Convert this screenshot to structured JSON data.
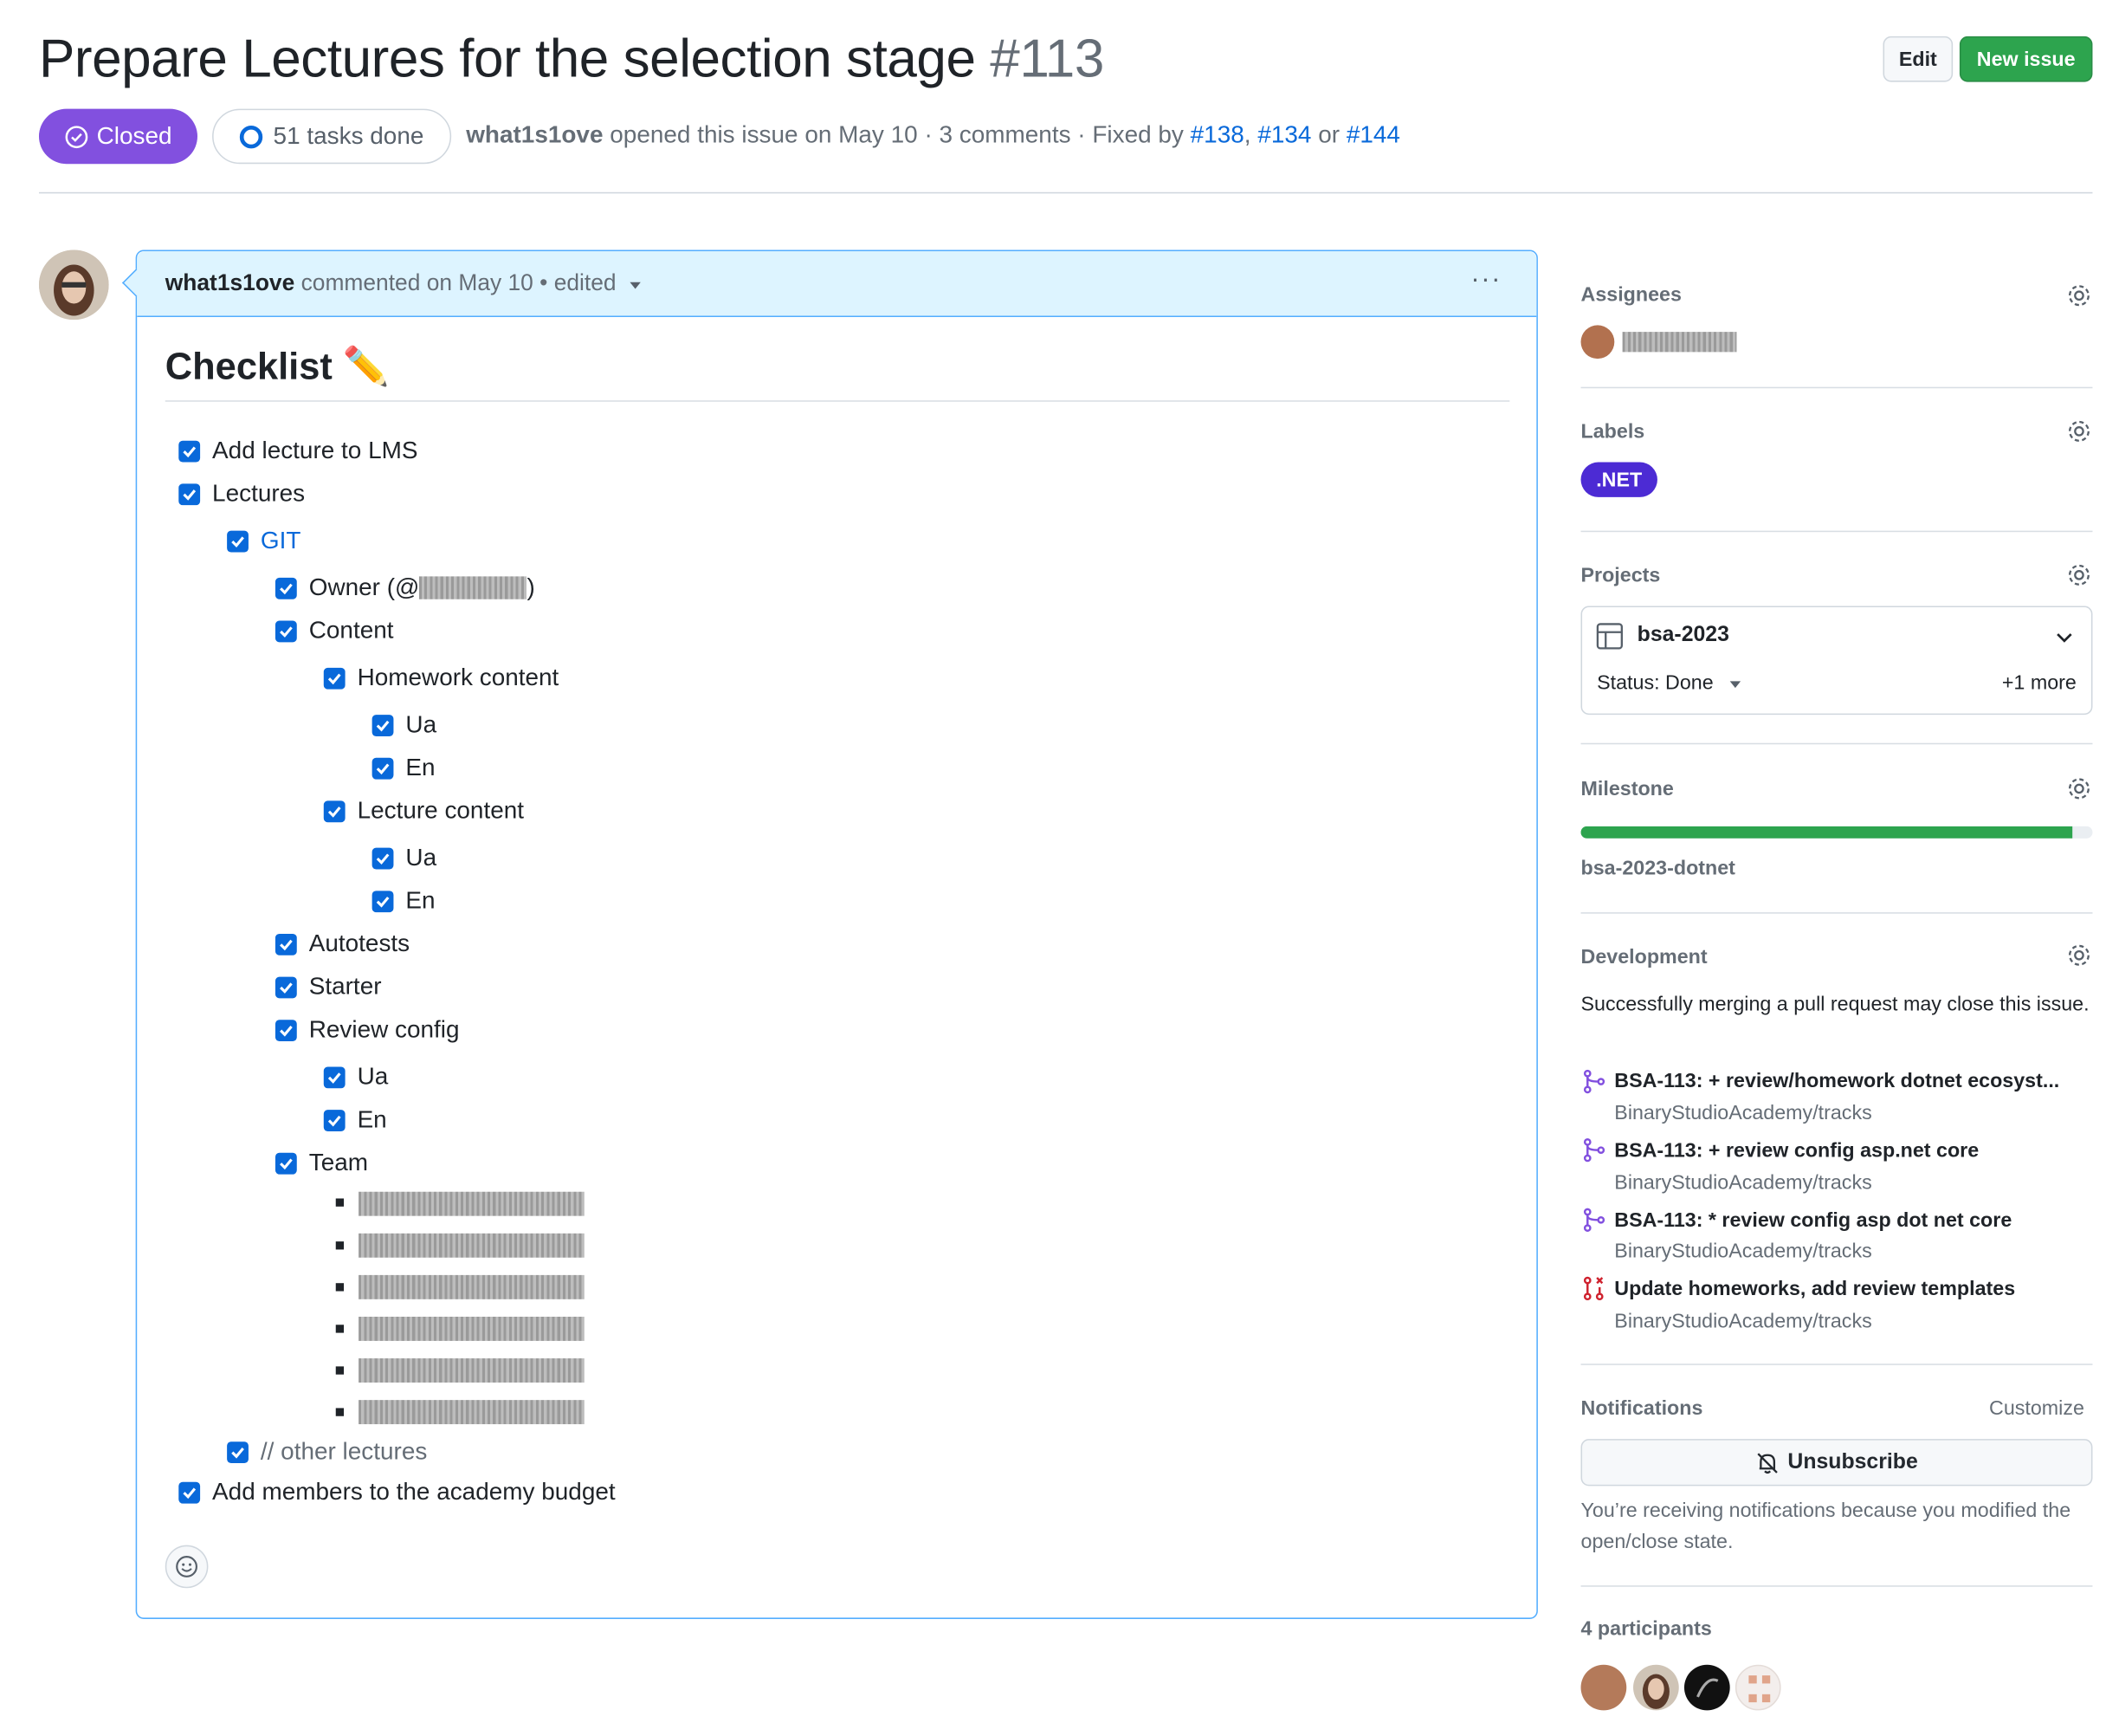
{
  "issue": {
    "title": "Prepare Lectures for the selection stage",
    "number": "#113",
    "state": "Closed",
    "tasks": "51 tasks done",
    "author": "what1s1ove",
    "opened_text": "opened this issue on May 10 · 3 comments · Fixed by",
    "fixed_by": [
      "#138",
      "#134",
      "#144"
    ],
    "sep_comma": ",",
    "sep_or": "or"
  },
  "header_buttons": {
    "edit": "Edit",
    "new_issue": "New issue"
  },
  "comment": {
    "author": "what1s1ove",
    "meta": "commented on May 10 • edited",
    "menu": "···",
    "heading": "Checklist ✏️",
    "items": {
      "add_lecture": "Add lecture to LMS",
      "lectures": "Lectures",
      "git": "GIT",
      "owner_prefix": "Owner (@",
      "owner_suffix": ")",
      "content": "Content",
      "homework_content": "Homework content",
      "ua1": "Ua",
      "en1": "En",
      "lecture_content": "Lecture content",
      "ua2": "Ua",
      "en2": "En",
      "autotests": "Autotests",
      "starter": "Starter",
      "review_config": "Review config",
      "ua3": "Ua",
      "en3": "En",
      "team": "Team",
      "other_lectures": "// other lectures",
      "add_members": "Add members to the academy budget"
    }
  },
  "sidebar": {
    "assignees": "Assignees",
    "labels": "Labels",
    "label_net": ".NET",
    "projects": "Projects",
    "project_name": "bsa-2023",
    "project_status": "Status: Done",
    "project_more": "+1 more",
    "milestone": "Milestone",
    "milestone_name": "bsa-2023-dotnet",
    "milestone_progress": 0.96,
    "development": "Development",
    "development_text": "Successfully merging a pull request may close this issue.",
    "prs": [
      {
        "title": "BSA-113: + review/homework dotnet ecosyst...",
        "repo": "BinaryStudioAcademy/tracks"
      },
      {
        "title": "BSA-113: + review config asp.net core",
        "repo": "BinaryStudioAcademy/tracks"
      },
      {
        "title": "BSA-113: * review config asp dot net core",
        "repo": "BinaryStudioAcademy/tracks"
      },
      {
        "title": "Update homeworks, add review templates",
        "repo": "BinaryStudioAcademy/tracks"
      }
    ],
    "notifications": "Notifications",
    "customize": "Customize",
    "unsubscribe": "Unsubscribe",
    "notif_text": "You’re receiving notifications because you modified the open/close state.",
    "participants": "4 participants"
  },
  "colors": {
    "closed": "#8250df",
    "checkbox": "#0969da",
    "link": "#0969da",
    "label_net": "#4c2bd4",
    "progress": "#2da44e"
  }
}
